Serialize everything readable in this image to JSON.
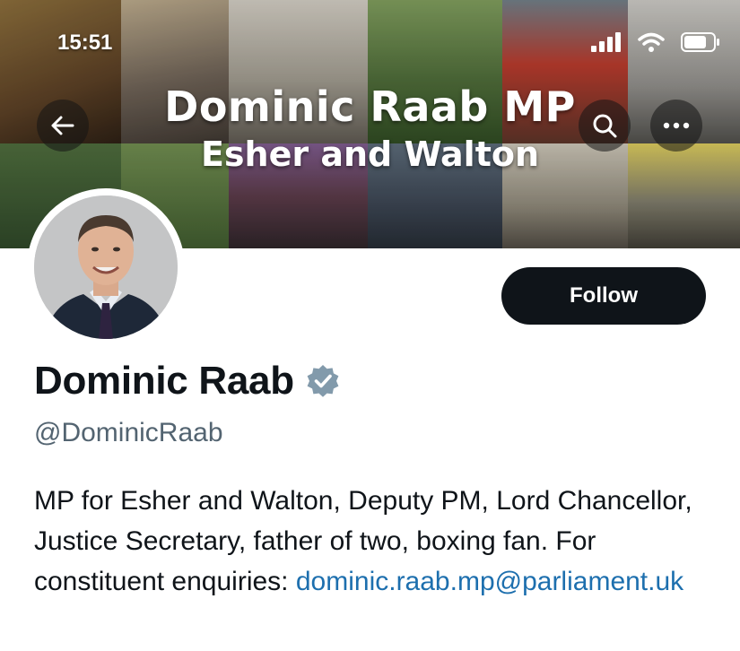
{
  "status_bar": {
    "time": "15:51"
  },
  "banner": {
    "title": "Dominic Raab MP",
    "subtitle": "Esher and Walton"
  },
  "profile": {
    "display_name": "Dominic Raab",
    "verified": true,
    "verified_color": "#829aab",
    "handle": "@DominicRaab",
    "follow_label": "Follow",
    "bio": "MP for Esher and Walton, Deputy PM, Lord Chancellor, Justice Secretary, father of two, boxing fan. For constituent enquiries:",
    "bio_link": "dominic.raab.mp@parliament.uk"
  },
  "icons": {
    "back": "arrow-left-icon",
    "search": "search-icon",
    "more": "more-horizontal-icon",
    "verified": "verified-badge-icon"
  },
  "colors": {
    "link": "#1d6fae",
    "follow_button": "#0f1419",
    "handle": "#536471"
  }
}
